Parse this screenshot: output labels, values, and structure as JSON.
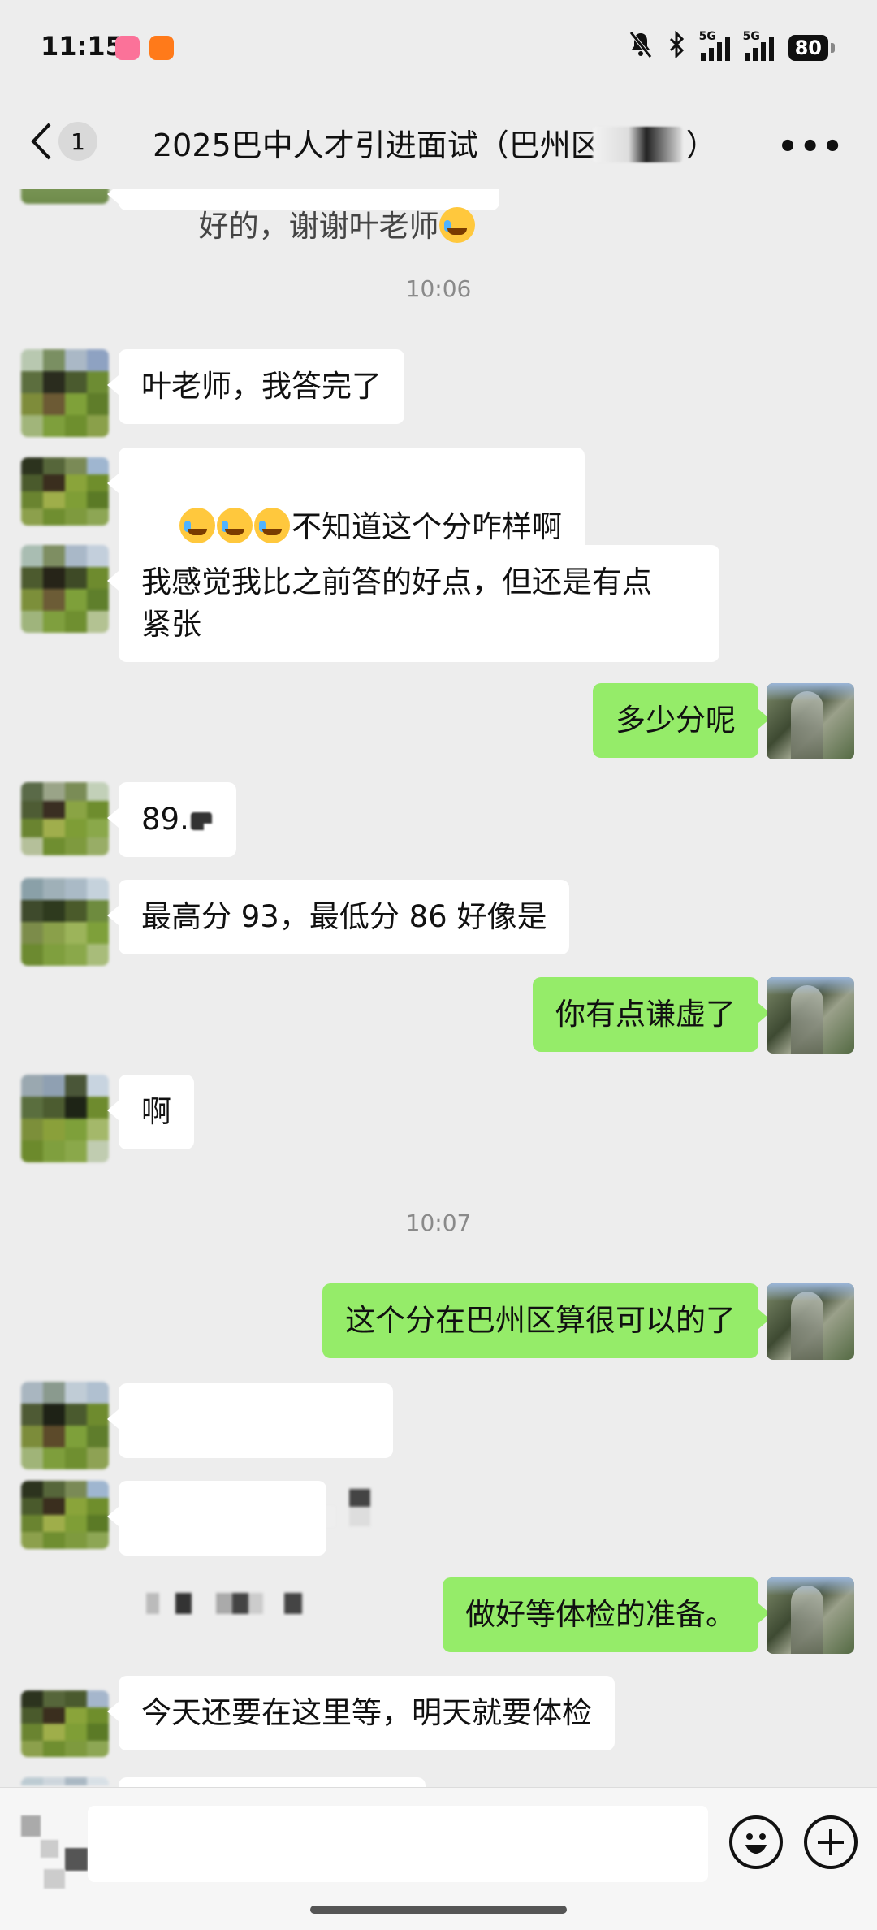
{
  "status_bar": {
    "time": "11:15",
    "battery": "80",
    "network_1": "5G",
    "network_2": "5G",
    "icons": [
      "bilibili-app-icon",
      "orange-app-icon",
      "mute-bell-icon",
      "bluetooth-icon",
      "signal-icon",
      "signal-icon",
      "battery-icon"
    ]
  },
  "nav": {
    "back_icon": "chevron-left-icon",
    "unread_count": "1",
    "title": "2025巴中人才引进面试（巴州区",
    "title_end": "）",
    "more_icon": "more-dots-icon"
  },
  "chat": {
    "partial_top": "好的，谢谢叶老师",
    "time_1": "10:06",
    "msg_1": "叶老师，我答完了",
    "msg_2_text": "不知道这个分咋样啊",
    "msg_3": "我感觉我比之前答的好点，但还是有点\n紧张",
    "msg_4": "多少分呢",
    "msg_5": "89.",
    "msg_6": "最高分 93，最低分 86 好像是",
    "msg_7": "你有点谦虚了",
    "msg_8": "啊",
    "time_2": "10:07",
    "msg_9": "这个分在巴州区算很可以的了",
    "msg_12": "做好等体检的准备。",
    "msg_13": "今天还要在这里等，明天就要体检"
  },
  "bottom": {
    "emoji_icon": "smiley-icon",
    "plus_icon": "plus-circle-icon"
  },
  "colors": {
    "background": "#ededed",
    "self_bubble": "#95ec69",
    "other_bubble": "#ffffff"
  }
}
